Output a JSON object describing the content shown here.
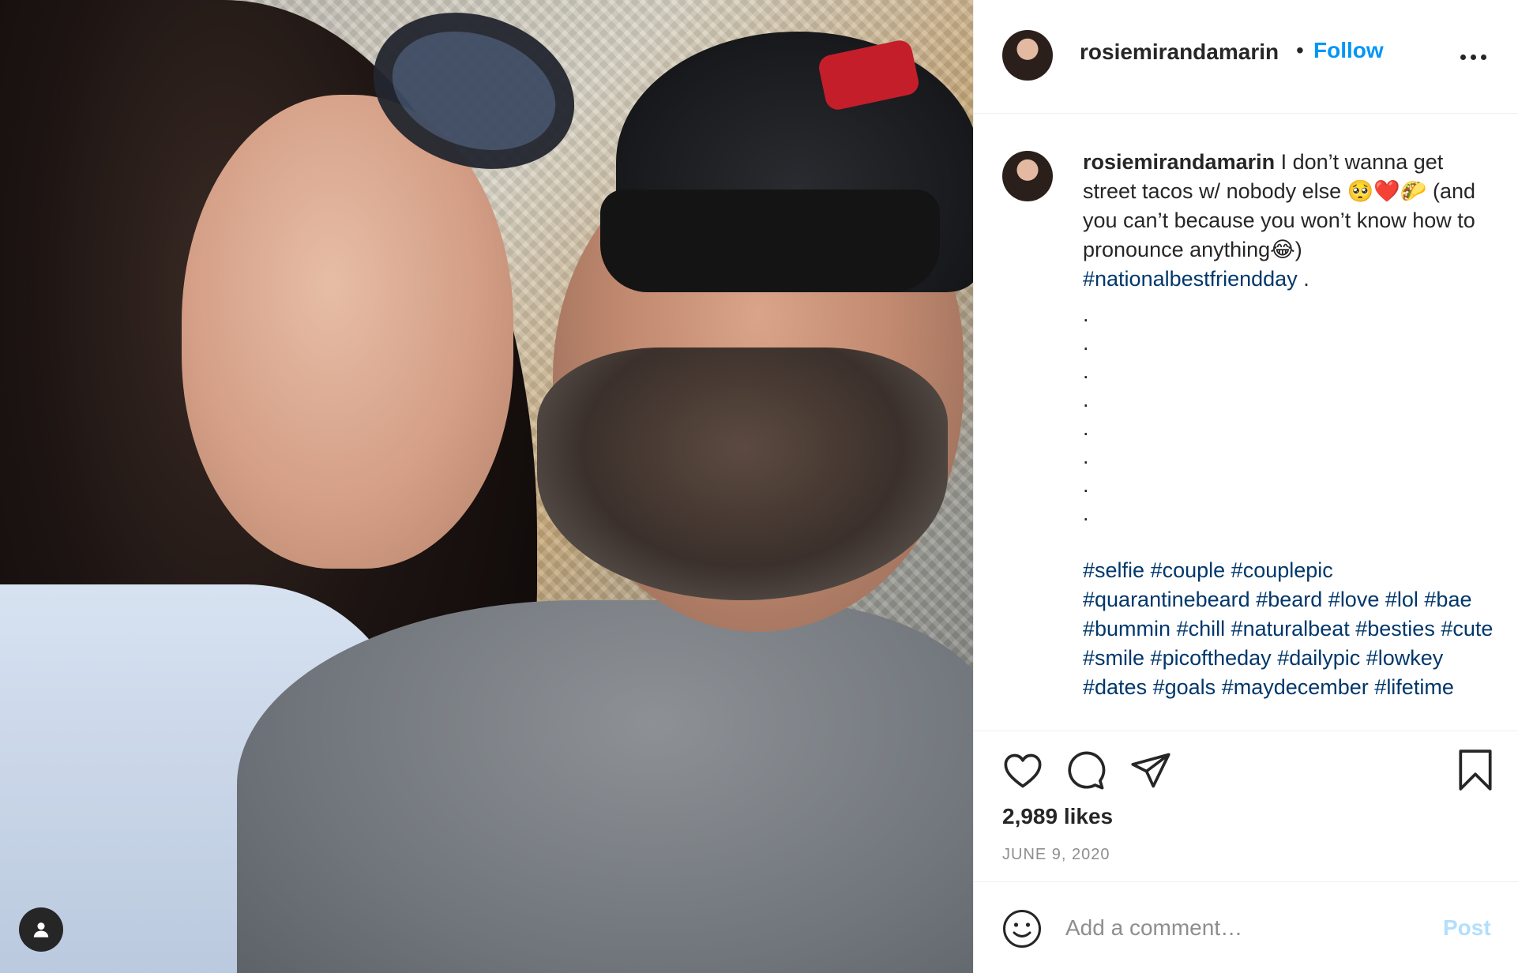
{
  "post": {
    "username": "rosiemirandamarin",
    "follow_label": "Follow",
    "separator": "•",
    "more_icon": "more-horizontal-icon"
  },
  "caption": {
    "username": "rosiemirandamarin",
    "line1": "I don’t wanna get street tacos w/ nobody else 🥺❤️🌮 (and you can’t because you won’t know how to pronounce anything😂)",
    "first_tag": "#nationalbestfriendday",
    "first_tag_suffix": " .",
    "dots": [
      ".",
      ".",
      ".",
      ".",
      ".",
      ".",
      ".",
      "."
    ],
    "tags": [
      "#selfie",
      "#couple",
      "#couplepic",
      "#quarantinebeard",
      "#beard",
      "#love",
      "#lol",
      "#bae",
      "#bummin",
      "#chill",
      "#naturalbeat",
      "#besties",
      "#cute",
      "#smile",
      "#picoftheday",
      "#dailypic",
      "#lowkey",
      "#dates",
      "#goals",
      "#maydecember",
      "#lifetime"
    ]
  },
  "actions": {
    "likes_text": "2,989 likes",
    "date_text": "JUNE 9, 2020",
    "icons": [
      "heart-icon",
      "comment-icon",
      "share-icon",
      "bookmark-icon"
    ]
  },
  "comment_box": {
    "placeholder": "Add a comment…",
    "post_label": "Post"
  },
  "colors": {
    "accent": "#0095f6",
    "hashtag": "#00376b",
    "muted": "#8e8e8e",
    "post_disabled": "#b2dffc"
  }
}
